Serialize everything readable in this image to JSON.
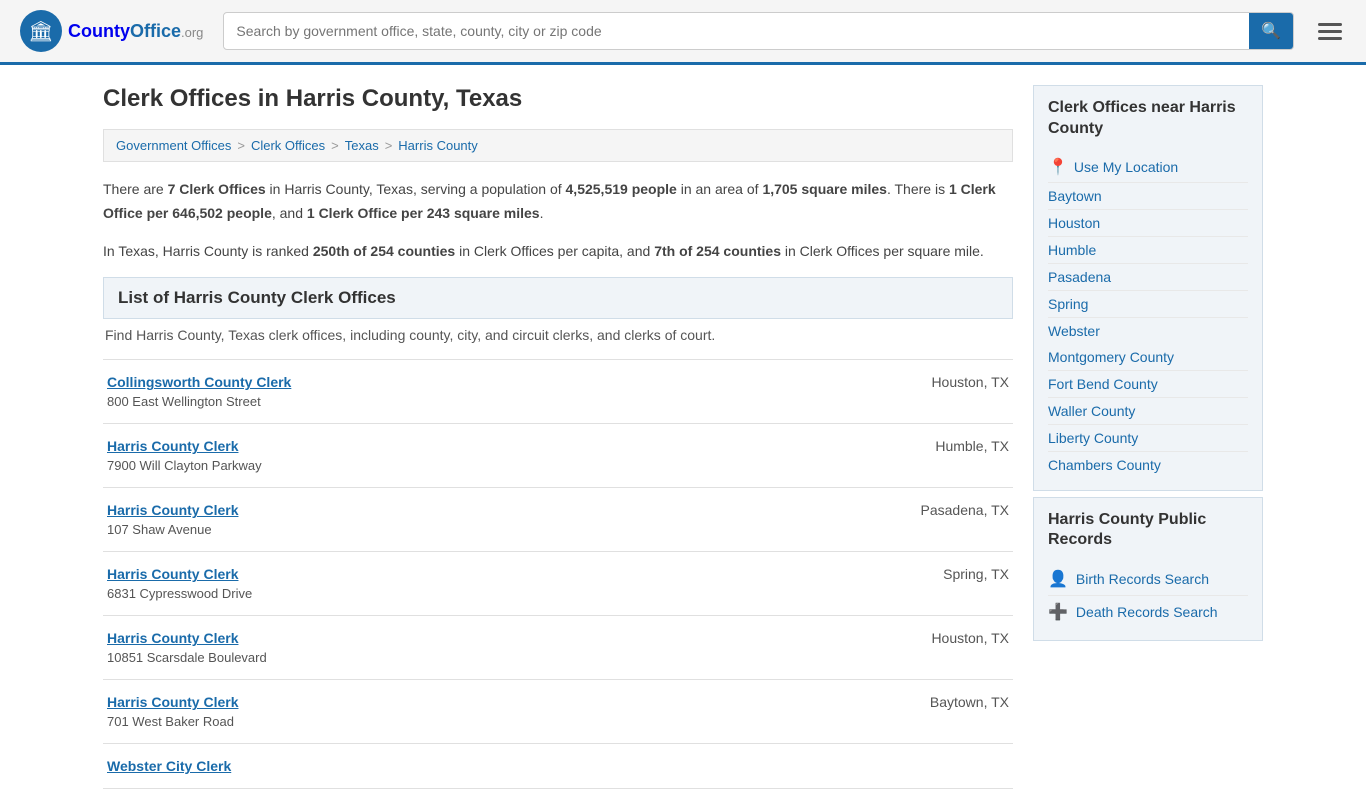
{
  "header": {
    "logo_text": "CountyOffice",
    "logo_org": ".org",
    "search_placeholder": "Search by government office, state, county, city or zip code",
    "search_icon": "🔍"
  },
  "page": {
    "title": "Clerk Offices in Harris County, Texas"
  },
  "breadcrumb": {
    "items": [
      {
        "label": "Government Offices",
        "href": "#"
      },
      {
        "label": "Clerk Offices",
        "href": "#"
      },
      {
        "label": "Texas",
        "href": "#"
      },
      {
        "label": "Harris County",
        "href": "#"
      }
    ]
  },
  "info": {
    "paragraph1": "There are 7 Clerk Offices in Harris County, Texas, serving a population of 4,525,519 people in an area of 1,705 square miles. There is 1 Clerk Office per 646,502 people, and 1 Clerk Office per 243 square miles.",
    "paragraph2": "In Texas, Harris County is ranked 250th of 254 counties in Clerk Offices per capita, and 7th of 254 counties in Clerk Offices per square mile."
  },
  "section": {
    "title": "List of Harris County Clerk Offices",
    "description": "Find Harris County, Texas clerk offices, including county, city, and circuit clerks, and clerks of court."
  },
  "clerks": [
    {
      "name": "Collingsworth County Clerk",
      "address": "800 East Wellington Street",
      "location": "Houston, TX"
    },
    {
      "name": "Harris County Clerk",
      "address": "7900 Will Clayton Parkway",
      "location": "Humble, TX"
    },
    {
      "name": "Harris County Clerk",
      "address": "107 Shaw Avenue",
      "location": "Pasadena, TX"
    },
    {
      "name": "Harris County Clerk",
      "address": "6831 Cypresswood Drive",
      "location": "Spring, TX"
    },
    {
      "name": "Harris County Clerk",
      "address": "10851 Scarsdale Boulevard",
      "location": "Houston, TX"
    },
    {
      "name": "Harris County Clerk",
      "address": "701 West Baker Road",
      "location": "Baytown, TX"
    },
    {
      "name": "Webster City Clerk",
      "address": "",
      "location": ""
    }
  ],
  "sidebar": {
    "nearby_title": "Clerk Offices near Harris County",
    "use_my_location": "Use My Location",
    "cities": [
      {
        "label": "Baytown"
      },
      {
        "label": "Houston"
      },
      {
        "label": "Humble"
      },
      {
        "label": "Pasadena"
      },
      {
        "label": "Spring"
      },
      {
        "label": "Webster"
      }
    ],
    "counties": [
      {
        "label": "Montgomery County"
      },
      {
        "label": "Fort Bend County"
      },
      {
        "label": "Waller County"
      },
      {
        "label": "Liberty County"
      },
      {
        "label": "Chambers County"
      }
    ],
    "public_records_title": "Harris County Public Records",
    "records_links": [
      {
        "label": "Birth Records Search",
        "icon": "👤"
      },
      {
        "label": "Death Records Search",
        "icon": "➕"
      }
    ]
  }
}
